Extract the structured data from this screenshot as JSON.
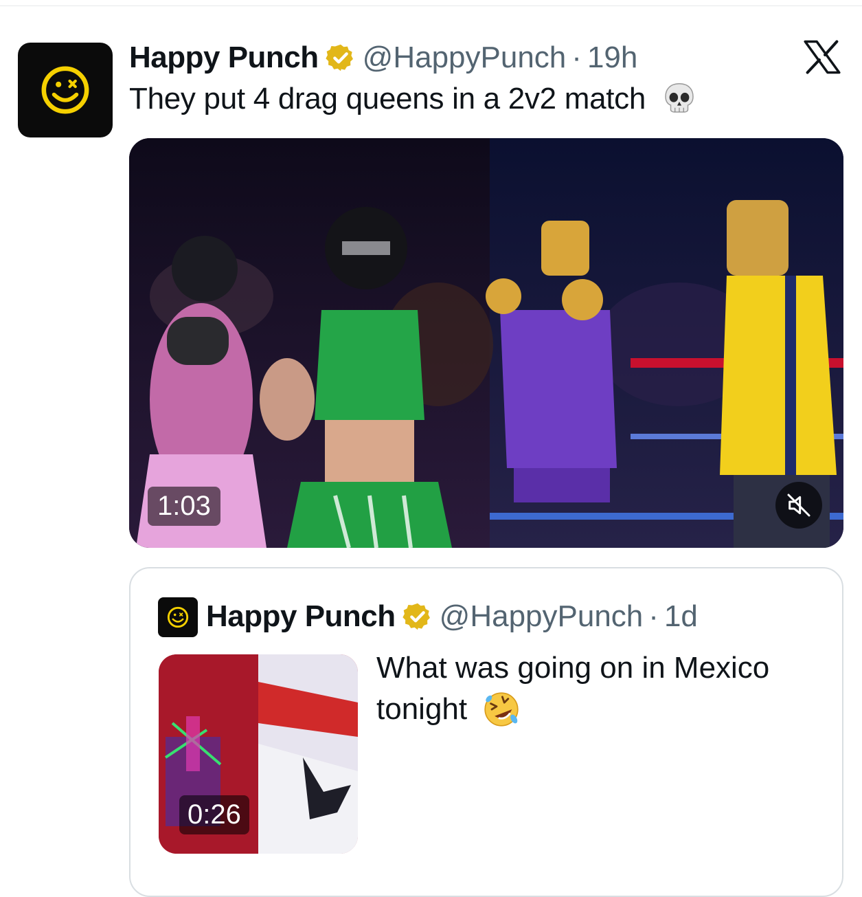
{
  "tweet": {
    "display_name": "Happy Punch",
    "handle": "@HappyPunch",
    "separator": "·",
    "time": "19h",
    "text": "They put 4 drag queens in a 2v2 match",
    "emoji": "skull-emoji",
    "media": {
      "type": "video",
      "duration": "1:03",
      "muted": true
    }
  },
  "quote": {
    "display_name": "Happy Punch",
    "handle": "@HappyPunch",
    "separator": "·",
    "time": "1d",
    "text": "What was going on in Mexico tonight",
    "emoji": "rolling-on-floor-laughing-emoji",
    "media": {
      "type": "video",
      "duration": "0:26"
    }
  },
  "colors": {
    "text_primary": "#0f1419",
    "text_secondary": "#536471",
    "verified_gold": "#e2b719",
    "avatar_bg": "#0b0b0b",
    "logo_yellow": "#f5d000",
    "border": "#d9dee2"
  },
  "icons": {
    "brand": "x-logo-icon",
    "verified": "verified-badge-icon",
    "mute": "volume-muted-icon"
  }
}
